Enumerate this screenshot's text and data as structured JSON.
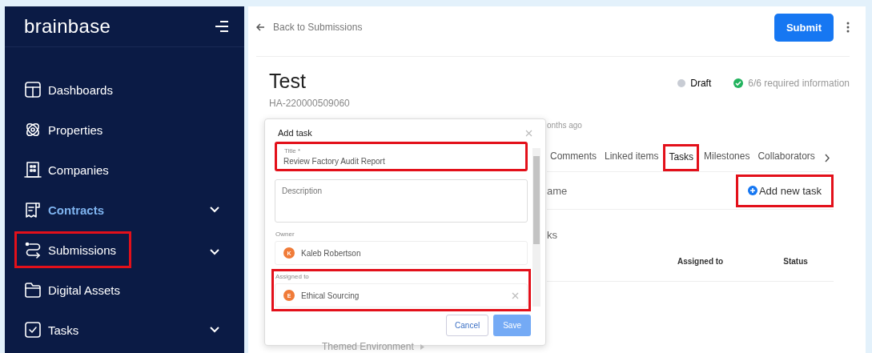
{
  "sidebar": {
    "brand": "brainbase",
    "items": [
      {
        "label": "Dashboards",
        "selected": false,
        "expandable": false,
        "highlighted": false
      },
      {
        "label": "Properties",
        "selected": false,
        "expandable": false,
        "highlighted": false
      },
      {
        "label": "Companies",
        "selected": false,
        "expandable": false,
        "highlighted": false
      },
      {
        "label": "Contracts",
        "selected": true,
        "expandable": true,
        "highlighted": false
      },
      {
        "label": "Submissions",
        "selected": false,
        "expandable": true,
        "highlighted": true
      },
      {
        "label": "Digital Assets",
        "selected": false,
        "expandable": false,
        "highlighted": false
      },
      {
        "label": "Tasks",
        "selected": false,
        "expandable": true,
        "highlighted": false
      }
    ]
  },
  "back_link": "Back to Submissions",
  "submit_button": "Submit",
  "record": {
    "title": "Test",
    "id": "HA-220000509060",
    "status": "Draft",
    "requirements": "6/6 required information",
    "updated": "onths ago"
  },
  "tabs": [
    {
      "label": "Comments",
      "selected": false,
      "highlighted": false
    },
    {
      "label": "Linked items",
      "selected": false,
      "highlighted": false
    },
    {
      "label": "Tasks",
      "selected": true,
      "highlighted": true
    },
    {
      "label": "Milestones",
      "selected": false,
      "highlighted": false
    },
    {
      "label": "Collaborators",
      "selected": false,
      "highlighted": false
    }
  ],
  "tasks_panel": {
    "name_fragment": "ame",
    "add_button": {
      "label": "Add new task",
      "highlighted": true
    },
    "section_fragment": "ks",
    "columns": [
      "Assigned to",
      "Status"
    ]
  },
  "dialog": {
    "title": "Add task",
    "fields": [
      {
        "kind": "text",
        "label": "Title *",
        "value": "Review Factory Audit Report",
        "highlighted": true
      },
      {
        "kind": "textarea",
        "placeholder": "Description",
        "highlighted": false
      },
      {
        "kind": "person",
        "label": "Owner",
        "value": "Kaleb Robertson",
        "avatar": "K",
        "clearable": false,
        "highlighted": false
      },
      {
        "kind": "person",
        "label": "Assigned to",
        "value": "Ethical Sourcing",
        "avatar": "E",
        "clearable": true,
        "highlighted": true
      }
    ],
    "cancel_button": "Cancel",
    "save_button": {
      "label": "Save",
      "disabled": true
    }
  },
  "breadcrumb_fragment": "Themed Environment"
}
